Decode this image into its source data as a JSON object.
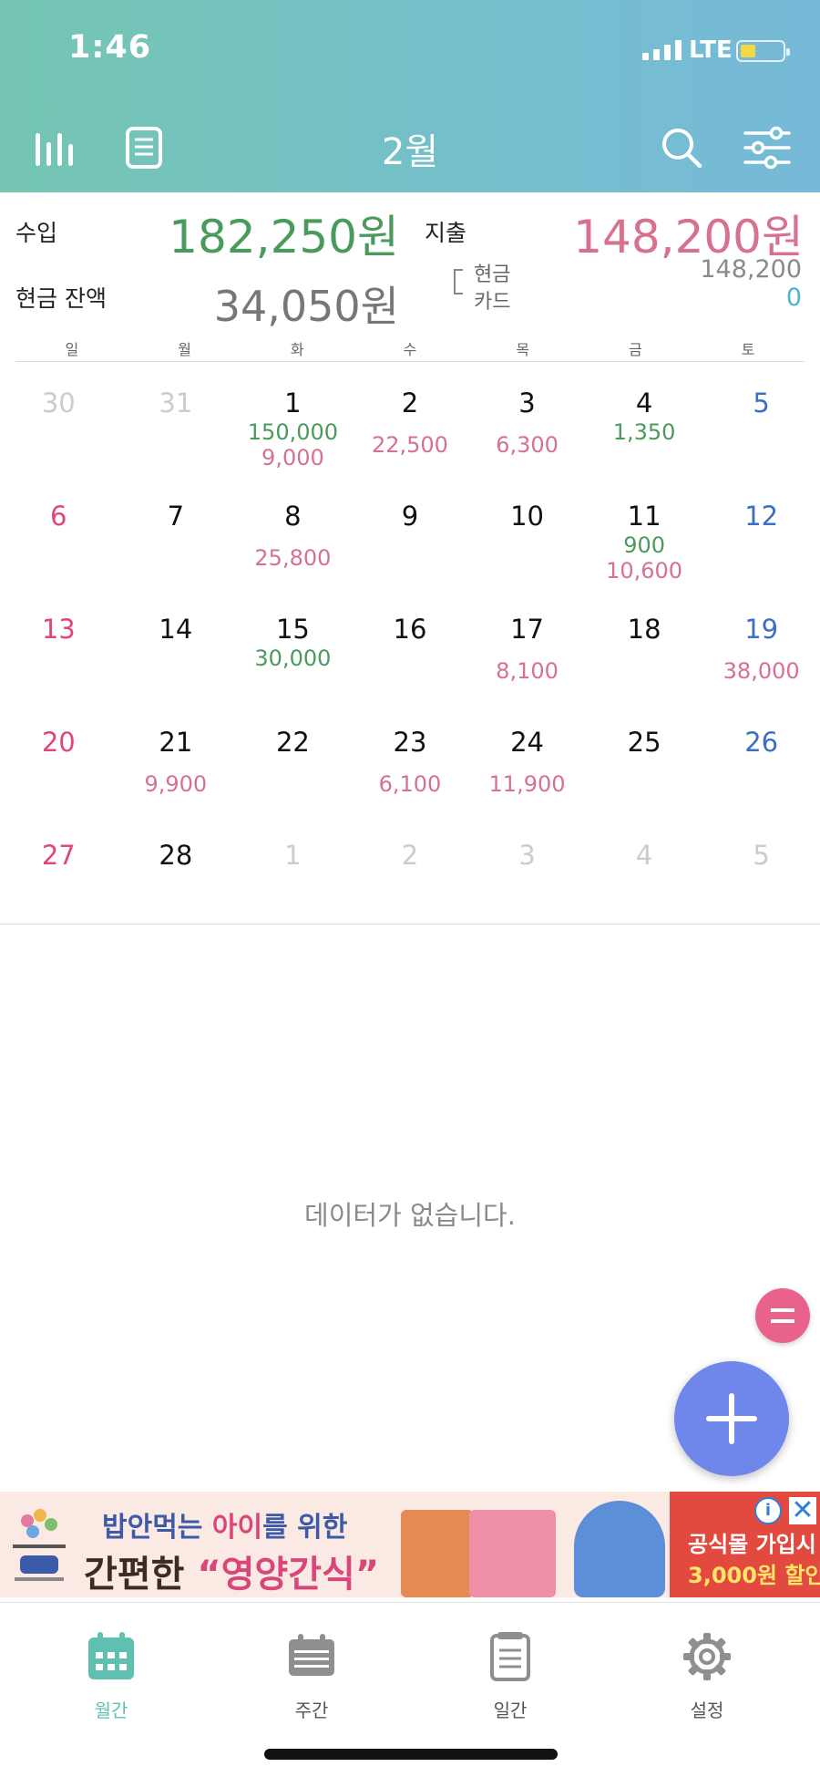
{
  "status_bar": {
    "time": "1:46",
    "network": "LTE",
    "battery_fill": 0.35
  },
  "header": {
    "month": "2월"
  },
  "summary": {
    "income_label": "수입",
    "income_amount": "182,250원",
    "expense_label": "지출",
    "expense_amount": "148,200원",
    "balance_label": "현금 잔액",
    "balance_amount": "34,050원",
    "cash_label": "현금",
    "cash_amount": "148,200",
    "card_label": "카드",
    "card_amount": "0"
  },
  "weekdays": [
    "일",
    "월",
    "화",
    "수",
    "목",
    "금",
    "토"
  ],
  "colors": {
    "income": "#4a9a5e",
    "expense": "#d6718e",
    "sunday": "#e0457b",
    "saturday": "#3a6fc4",
    "accent": "#6f86ea"
  },
  "calendar": [
    [
      {
        "day": "30",
        "dim": true
      },
      {
        "day": "31",
        "dim": true
      },
      {
        "day": "1",
        "income": "150,000",
        "expense": "9,000"
      },
      {
        "day": "2",
        "expense": "22,500"
      },
      {
        "day": "3",
        "expense": "6,300"
      },
      {
        "day": "4",
        "income": "1,350"
      },
      {
        "day": "5"
      }
    ],
    [
      {
        "day": "6"
      },
      {
        "day": "7"
      },
      {
        "day": "8",
        "expense": "25,800"
      },
      {
        "day": "9"
      },
      {
        "day": "10"
      },
      {
        "day": "11",
        "income": "900",
        "expense": "10,600"
      },
      {
        "day": "12"
      }
    ],
    [
      {
        "day": "13"
      },
      {
        "day": "14"
      },
      {
        "day": "15",
        "income": "30,000"
      },
      {
        "day": "16"
      },
      {
        "day": "17",
        "expense": "8,100"
      },
      {
        "day": "18"
      },
      {
        "day": "19",
        "expense": "38,000"
      }
    ],
    [
      {
        "day": "20"
      },
      {
        "day": "21",
        "expense": "9,900"
      },
      {
        "day": "22"
      },
      {
        "day": "23",
        "expense": "6,100"
      },
      {
        "day": "24",
        "expense": "11,900"
      },
      {
        "day": "25"
      },
      {
        "day": "26"
      }
    ],
    [
      {
        "day": "27"
      },
      {
        "day": "28"
      },
      {
        "day": "1",
        "dim": true
      },
      {
        "day": "2",
        "dim": true
      },
      {
        "day": "3",
        "dim": true
      },
      {
        "day": "4",
        "dim": true
      },
      {
        "day": "5",
        "dim": true
      }
    ]
  ],
  "empty_message": "데이터가 없습니다.",
  "ad": {
    "line1_a": "밥안먹는 ",
    "line1_b": "아이",
    "line1_c": "를 위한",
    "line2_a": "간편한 ",
    "line2_b": "“영양간식”",
    "right1": "공식몰 가입시",
    "right2": "3,000원 할인",
    "info_icon": "i",
    "close_icon": "✕"
  },
  "tabs": [
    {
      "label": "월간",
      "icon": "calendar-grid-icon",
      "active": true
    },
    {
      "label": "주간",
      "icon": "calendar-week-icon",
      "active": false
    },
    {
      "label": "일간",
      "icon": "daily-list-icon",
      "active": false
    },
    {
      "label": "설정",
      "icon": "gear-icon",
      "active": false
    }
  ]
}
